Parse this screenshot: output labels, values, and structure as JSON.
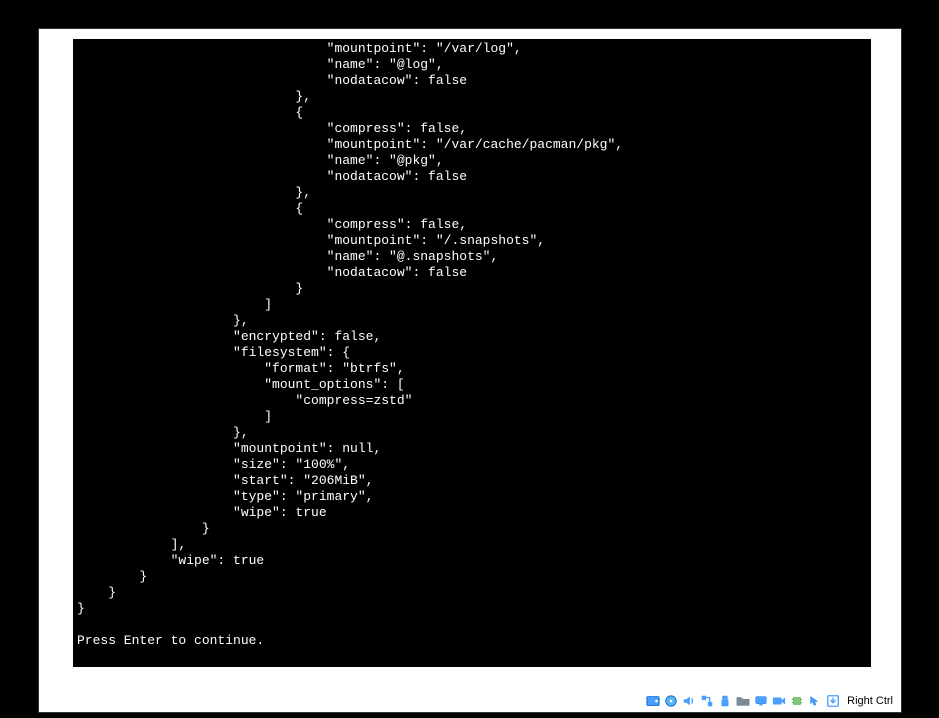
{
  "terminal": {
    "lines": [
      "                                \"mountpoint\": \"/var/log\",",
      "                                \"name\": \"@log\",",
      "                                \"nodatacow\": false",
      "                            },",
      "                            {",
      "                                \"compress\": false,",
      "                                \"mountpoint\": \"/var/cache/pacman/pkg\",",
      "                                \"name\": \"@pkg\",",
      "                                \"nodatacow\": false",
      "                            },",
      "                            {",
      "                                \"compress\": false,",
      "                                \"mountpoint\": \"/.snapshots\",",
      "                                \"name\": \"@.snapshots\",",
      "                                \"nodatacow\": false",
      "                            }",
      "                        ]",
      "                    },",
      "                    \"encrypted\": false,",
      "                    \"filesystem\": {",
      "                        \"format\": \"btrfs\",",
      "                        \"mount_options\": [",
      "                            \"compress=zstd\"",
      "                        ]",
      "                    },",
      "                    \"mountpoint\": null,",
      "                    \"size\": \"100%\",",
      "                    \"start\": \"206MiB\",",
      "                    \"type\": \"primary\",",
      "                    \"wipe\": true",
      "                }",
      "            ],",
      "            \"wipe\": true",
      "        }",
      "    }",
      "}",
      "",
      "Press Enter to continue."
    ]
  },
  "statusbar": {
    "host_key": "Right Ctrl"
  }
}
